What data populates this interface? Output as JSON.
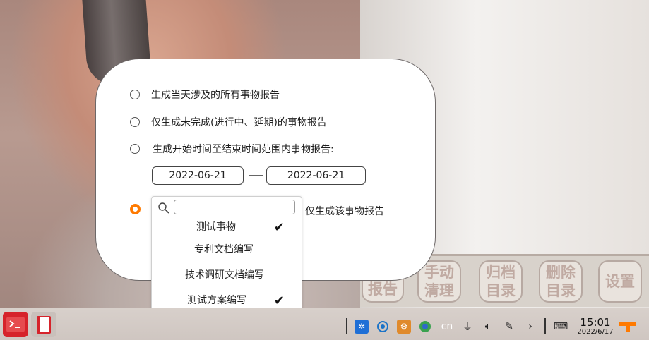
{
  "dialog": {
    "options": [
      {
        "label": "生成当天涉及的所有事物报告",
        "checked": false
      },
      {
        "label": "仅生成未完成(进行中、延期)的事物报告",
        "checked": false
      },
      {
        "label": "生成开始时间至结束时间范围内事物报告:",
        "checked": false
      },
      {
        "label": "仅生成该事物报告",
        "checked": true
      }
    ],
    "start_date": "2022-06-21",
    "end_date": "2022-06-21"
  },
  "dropdown": {
    "search_value": "",
    "items": [
      {
        "label": "测试事物",
        "checked": true
      },
      {
        "label": "专利文档编写",
        "checked": false
      },
      {
        "label": "技术调研文档编写",
        "checked": false
      },
      {
        "label": "测试方案编写",
        "checked": true
      }
    ]
  },
  "toolbar": {
    "report_label": "报告",
    "manual_clean_label": "手动\n清理",
    "archive_label": "归档\n目录",
    "delete_label": "删除\n目录",
    "settings_label": "设置"
  },
  "taskbar": {
    "input_method": "cn",
    "time": "15:01",
    "date": "2022/6/17"
  },
  "colors": {
    "accent": "#ff7a00",
    "terminal_app": "#d6232b"
  }
}
